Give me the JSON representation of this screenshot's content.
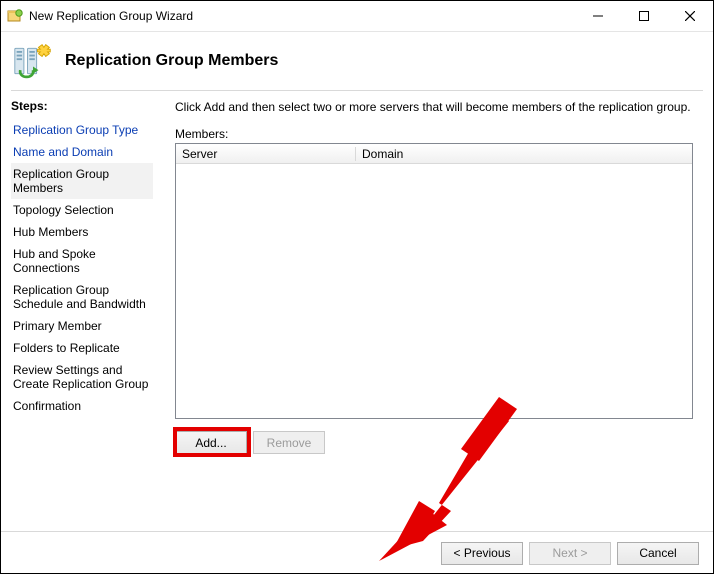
{
  "window": {
    "title": "New Replication Group Wizard"
  },
  "header": {
    "title": "Replication Group Members"
  },
  "sidebar": {
    "heading": "Steps:",
    "items": [
      {
        "label": "Replication Group Type",
        "state": "link"
      },
      {
        "label": "Name and Domain",
        "state": "link"
      },
      {
        "label": "Replication Group Members",
        "state": "current"
      },
      {
        "label": "Topology Selection",
        "state": "future"
      },
      {
        "label": "Hub Members",
        "state": "future"
      },
      {
        "label": "Hub and Spoke Connections",
        "state": "future"
      },
      {
        "label": "Replication Group Schedule and Bandwidth",
        "state": "future"
      },
      {
        "label": "Primary Member",
        "state": "future"
      },
      {
        "label": "Folders to Replicate",
        "state": "future"
      },
      {
        "label": "Review Settings and Create Replication Group",
        "state": "future"
      },
      {
        "label": "Confirmation",
        "state": "future"
      }
    ]
  },
  "main": {
    "instruction": "Click Add and then select two or more servers that will become members of the replication group.",
    "members_label": "Members:",
    "columns": {
      "server": "Server",
      "domain": "Domain"
    },
    "rows": []
  },
  "buttons": {
    "add": "Add...",
    "remove": "Remove",
    "previous": "< Previous",
    "next": "Next >",
    "cancel": "Cancel"
  }
}
